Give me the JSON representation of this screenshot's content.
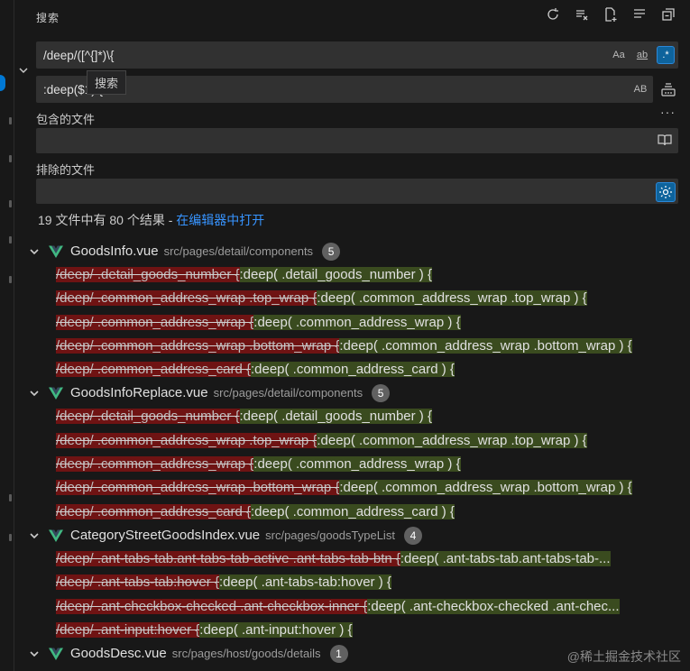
{
  "header": {
    "title": "搜索"
  },
  "search": {
    "value": "/deep/([^{]*)\\{",
    "opt_case": "Aa",
    "opt_word": "ab",
    "opt_regex": ".*"
  },
  "replace": {
    "value": ":deep($1) {",
    "opt_preserve": "AB"
  },
  "tooltip": "搜索",
  "include": {
    "label": "包含的文件",
    "value": ""
  },
  "exclude": {
    "label": "排除的文件",
    "value": ""
  },
  "summary": {
    "text": "19 文件中有 80 个结果 - ",
    "link": "在编辑器中打开"
  },
  "files": [
    {
      "name": "GoodsInfo.vue",
      "path": "src/pages/detail/components",
      "count": "5",
      "matches": [
        {
          "del": "/deep/ .detail_goods_number {",
          "ins": ":deep( .detail_goods_number ) {"
        },
        {
          "del": "/deep/ .common_address_wrap .top_wrap {",
          "ins": ":deep( .common_address_wrap .top_wrap ) {"
        },
        {
          "del": "/deep/ .common_address_wrap {",
          "ins": ":deep( .common_address_wrap ) {"
        },
        {
          "del": "/deep/ .common_address_wrap .bottom_wrap {",
          "ins": ":deep( .common_address_wrap .bottom_wrap ) {"
        },
        {
          "del": "/deep/ .common_address_card {",
          "ins": ":deep( .common_address_card ) {"
        }
      ]
    },
    {
      "name": "GoodsInfoReplace.vue",
      "path": "src/pages/detail/components",
      "count": "5",
      "matches": [
        {
          "del": "/deep/ .detail_goods_number {",
          "ins": ":deep( .detail_goods_number ) {"
        },
        {
          "del": "/deep/ .common_address_wrap .top_wrap {",
          "ins": ":deep( .common_address_wrap .top_wrap ) {"
        },
        {
          "del": "/deep/ .common_address_wrap {",
          "ins": ":deep( .common_address_wrap ) {"
        },
        {
          "del": "/deep/ .common_address_wrap .bottom_wrap {",
          "ins": ":deep( .common_address_wrap .bottom_wrap ) {"
        },
        {
          "del": "/deep/ .common_address_card {",
          "ins": ":deep( .common_address_card ) {"
        }
      ]
    },
    {
      "name": "CategoryStreetGoodsIndex.vue",
      "path": "src/pages/goodsTypeList",
      "count": "4",
      "matches": [
        {
          "del": "/deep/ .ant-tabs-tab.ant-tabs-tab-active .ant-tabs-tab-btn {",
          "ins": ":deep( .ant-tabs-tab.ant-tabs-tab-..."
        },
        {
          "del": "/deep/ .ant-tabs-tab:hover {",
          "ins": ":deep( .ant-tabs-tab:hover ) {"
        },
        {
          "del": "/deep/ .ant-checkbox-checked .ant-checkbox-inner {",
          "ins": ":deep( .ant-checkbox-checked .ant-chec..."
        },
        {
          "del": "/deep/ .ant-input:hover {",
          "ins": ":deep( .ant-input:hover ) {"
        }
      ]
    },
    {
      "name": "GoodsDesc.vue",
      "path": "src/pages/host/goods/details",
      "count": "1",
      "matches": []
    }
  ],
  "watermark": "@稀土掘金技术社区",
  "colors": {
    "vue_green": "#41b883",
    "vue_dark": "#35495e",
    "link": "#3794ff",
    "removed_bg": "#6f1313",
    "inserted_bg": "#3a4b1f"
  }
}
